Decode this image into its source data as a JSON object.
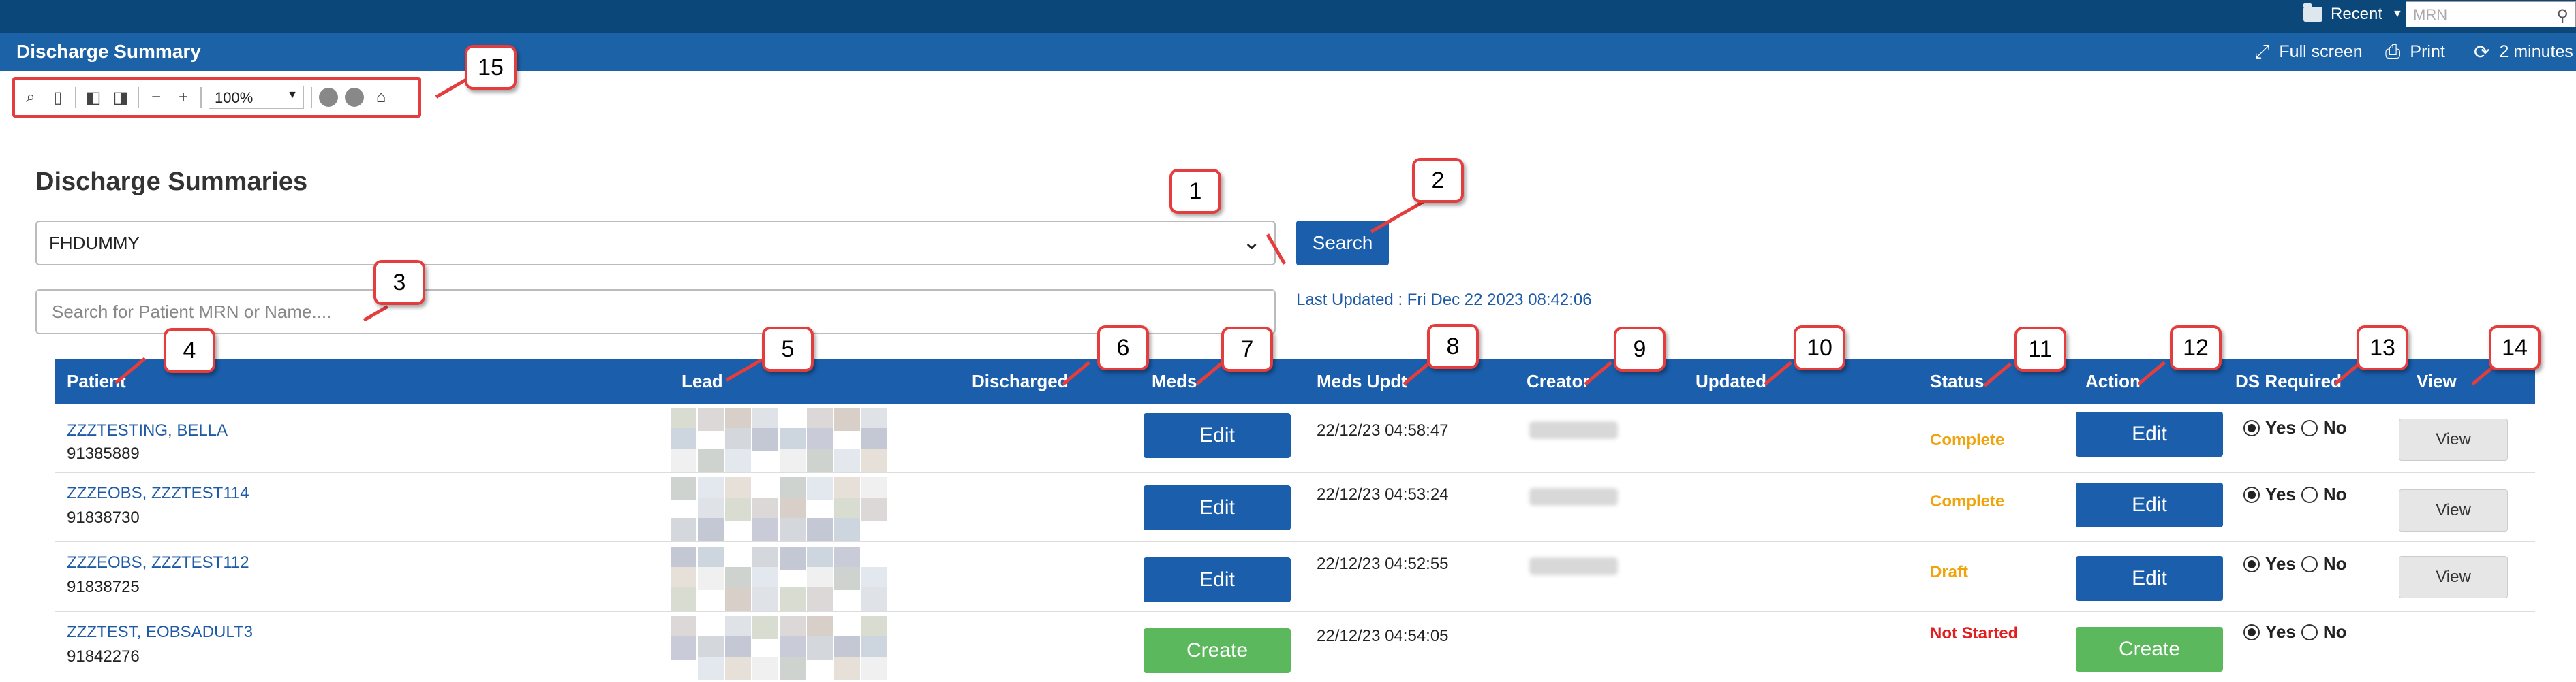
{
  "topbar": {
    "recent_label": "Recent",
    "mrn_placeholder": "MRN"
  },
  "titlebar": {
    "title": "Discharge Summary",
    "fullscreen_label": "Full screen",
    "print_label": "Print",
    "refresh_label": "2 minutes"
  },
  "toolbar": {
    "zoom_value": "100%"
  },
  "page": {
    "heading": "Discharge Summaries",
    "ward_value": "FHDUMMY",
    "search_button": "Search",
    "patient_search_placeholder": "Search for Patient MRN or Name....",
    "last_updated": "Last Updated : Fri Dec 22 2023 08:42:06"
  },
  "table": {
    "headers": [
      "Patient",
      "Lead",
      "Discharged",
      "Meds",
      "Meds Updt",
      "Creator",
      "Updated",
      "Status",
      "Action",
      "DS Required",
      "View"
    ],
    "rows": [
      {
        "name": "ZZZTESTING, BELLA",
        "mrn": "91385889",
        "meds_button": "Edit",
        "meds_updt": "22/12/23 04:58:47",
        "status": "Complete",
        "action_button": "Edit",
        "yes": "Yes",
        "no": "No",
        "view": "View"
      },
      {
        "name": "ZZZEOBS, ZZZTEST114",
        "mrn": "91838730",
        "meds_button": "Edit",
        "meds_updt": "22/12/23 04:53:24",
        "status": "Complete",
        "action_button": "Edit",
        "yes": "Yes",
        "no": "No",
        "view": "View"
      },
      {
        "name": "ZZZEOBS, ZZZTEST112",
        "mrn": "91838725",
        "meds_button": "Edit",
        "meds_updt": "22/12/23 04:52:55",
        "status": "Draft",
        "action_button": "Edit",
        "yes": "Yes",
        "no": "No",
        "view": "View"
      },
      {
        "name": "ZZZTEST, EOBSADULT3",
        "mrn": "91842276",
        "meds_button": "Create",
        "meds_updt": "22/12/23 04:54:05",
        "status": "Not Started",
        "action_button": "Create",
        "yes": "Yes",
        "no": "No",
        "view": ""
      }
    ]
  },
  "callouts": [
    "1",
    "2",
    "3",
    "4",
    "5",
    "6",
    "7",
    "8",
    "9",
    "10",
    "11",
    "12",
    "13",
    "14",
    "15"
  ],
  "colors": {
    "topbar": "#0b4778",
    "titlebar": "#1c62a7",
    "primary_button": "#1b5eab",
    "create_button": "#5cb85c",
    "status_complete": "#f0a30a",
    "status_not_started": "#e02020",
    "callout_border": "#e43d3d"
  }
}
